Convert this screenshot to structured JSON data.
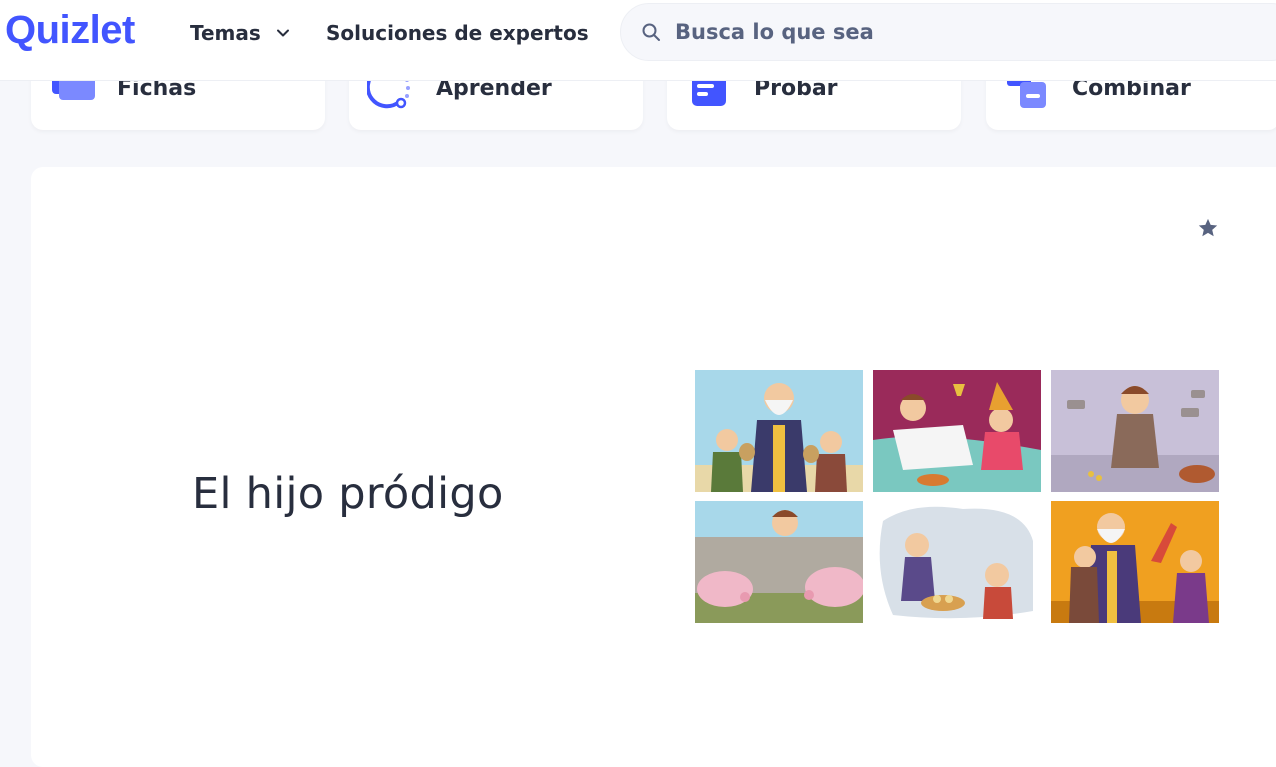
{
  "header": {
    "logo": "Quizlet",
    "nav_temas": "Temas",
    "nav_soluciones": "Soluciones de expertos",
    "search_placeholder": "Busca lo que sea"
  },
  "study_modes": [
    {
      "label": "Fichas",
      "icon": "flashcards-icon"
    },
    {
      "label": "Aprender",
      "icon": "learn-icon"
    },
    {
      "label": "Probar",
      "icon": "test-icon"
    },
    {
      "label": "Combinar",
      "icon": "match-icon"
    }
  ],
  "set": {
    "title": "El hijo pródigo",
    "star_icon": "star-icon",
    "image_panels": [
      "father-giving-money-bags",
      "son-feasting-with-woman",
      "son-sitting-poor-with-coins",
      "son-behind-wall-with-pigs",
      "son-hungry-with-bread",
      "father-embracing-son"
    ]
  },
  "colors": {
    "brand": "#4255ff",
    "text": "#282e3e",
    "muted": "#586380",
    "background": "#f6f7fb"
  }
}
